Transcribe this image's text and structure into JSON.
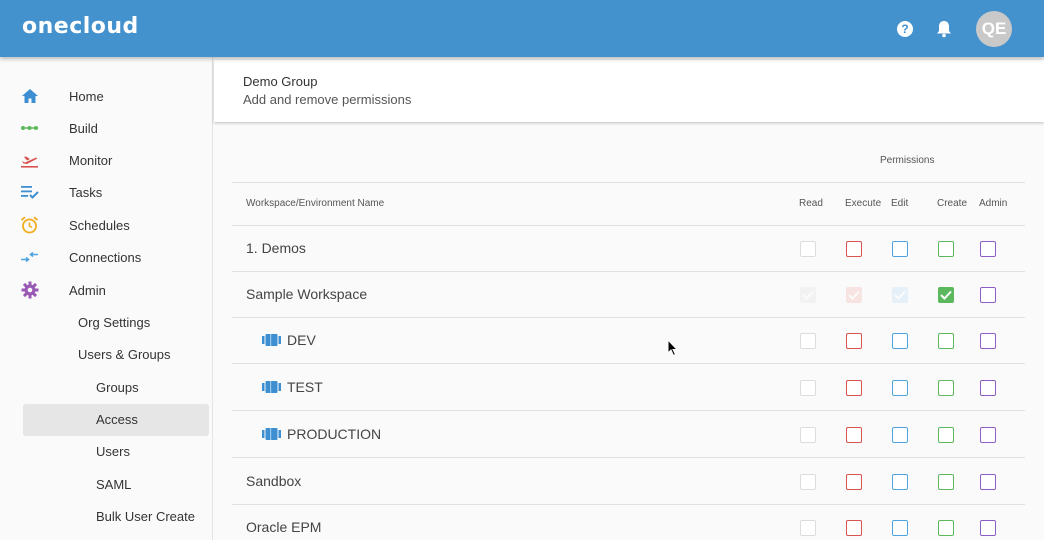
{
  "topbar": {
    "logo": "onecloud",
    "help_icon": "help-circle-icon",
    "bell_icon": "bell-icon",
    "avatar_initials": "QE",
    "color": "#4391cd"
  },
  "sidebar": {
    "items": [
      {
        "label": "Home",
        "icon": "home-icon",
        "color": "#3d8fd1"
      },
      {
        "label": "Build",
        "icon": "build-icon",
        "color": "#5cb85c"
      },
      {
        "label": "Monitor",
        "icon": "airplane-departure-icon",
        "color": "#d9534f"
      },
      {
        "label": "Tasks",
        "icon": "tasks-icon",
        "color": "#3d8fd1"
      },
      {
        "label": "Schedules",
        "icon": "alarm-clock-icon",
        "color": "#f0ad1e"
      },
      {
        "label": "Connections",
        "icon": "connections-icon",
        "color": "#4fa3de"
      },
      {
        "label": "Admin",
        "icon": "gear-icon",
        "color": "#9b59b6"
      }
    ],
    "admin_sub": [
      "Org Settings",
      "Users & Groups"
    ],
    "users_groups_sub": [
      "Groups",
      "Access",
      "Users",
      "SAML",
      "Bulk User Create"
    ],
    "active": "Access"
  },
  "header": {
    "title": "Demo Group",
    "subtitle": "Add and remove permissions"
  },
  "table": {
    "permissions_label": "Permissions",
    "columns": {
      "name": "Workspace/Environment Name",
      "read": "Read",
      "execute": "Execute",
      "edit": "Edit",
      "create": "Create",
      "admin": "Admin"
    },
    "rows": [
      {
        "name": "1. Demos",
        "level": 0,
        "read": false,
        "execute": false,
        "edit": false,
        "create": false,
        "admin": false,
        "inherited": false
      },
      {
        "name": "Sample Workspace",
        "level": 0,
        "read": true,
        "execute": true,
        "edit": true,
        "create": true,
        "admin": false,
        "inherited": true
      },
      {
        "name": "DEV",
        "level": 1,
        "read": false,
        "execute": false,
        "edit": false,
        "create": false,
        "admin": false,
        "inherited": false
      },
      {
        "name": "TEST",
        "level": 1,
        "read": false,
        "execute": false,
        "edit": false,
        "create": false,
        "admin": false,
        "inherited": false
      },
      {
        "name": "PRODUCTION",
        "level": 1,
        "read": false,
        "execute": false,
        "edit": false,
        "create": false,
        "admin": false,
        "inherited": false
      },
      {
        "name": "Sandbox",
        "level": 0,
        "read": false,
        "execute": false,
        "edit": false,
        "create": false,
        "admin": false,
        "inherited": false
      },
      {
        "name": "Oracle EPM",
        "level": 0,
        "read": false,
        "execute": false,
        "edit": false,
        "create": false,
        "admin": false,
        "inherited": false
      }
    ]
  }
}
